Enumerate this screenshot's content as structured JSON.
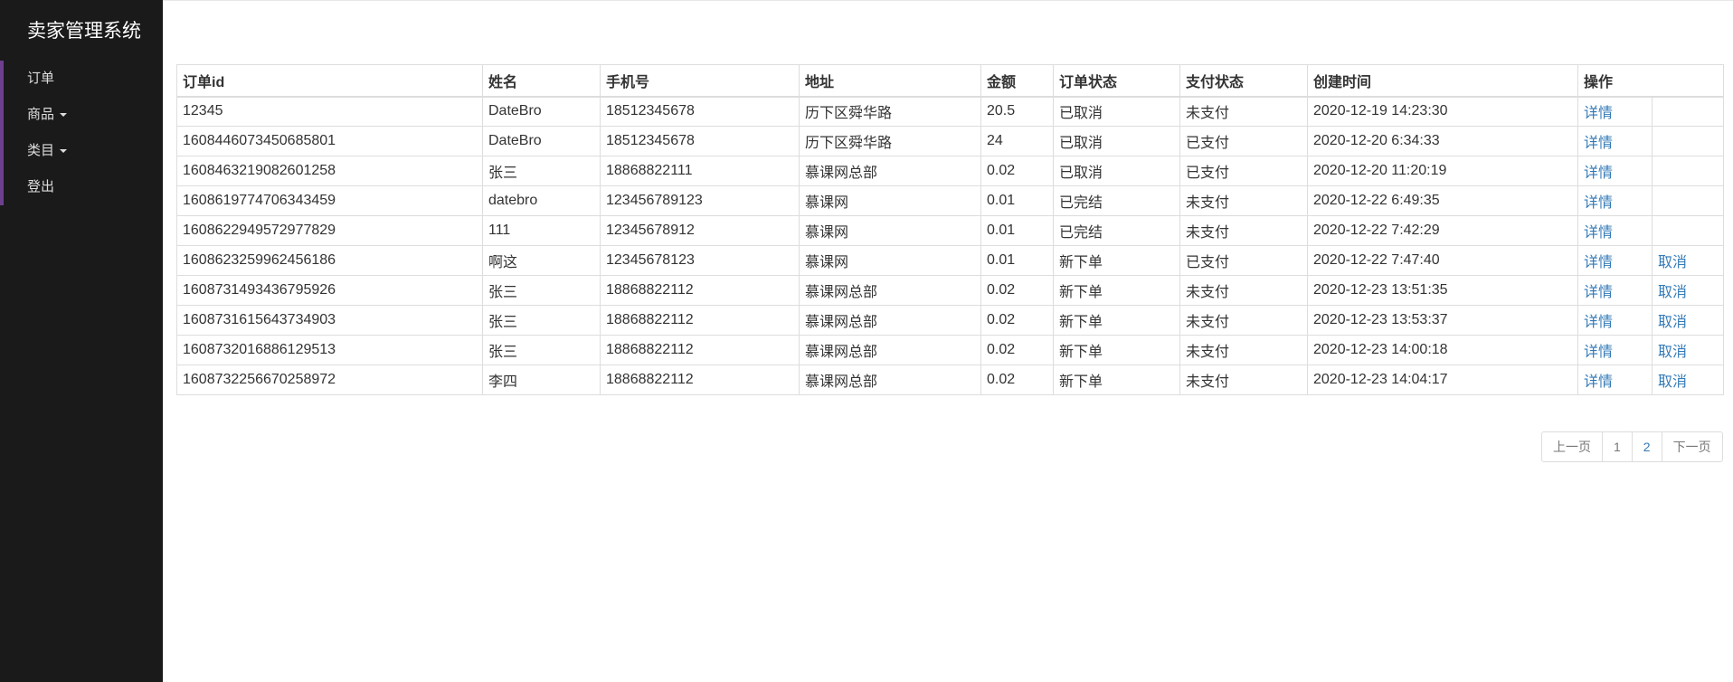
{
  "sidebar": {
    "brand": "卖家管理系统",
    "items": [
      {
        "name": "nav-orders",
        "label": "订单",
        "dropdown": false
      },
      {
        "name": "nav-products",
        "label": "商品",
        "dropdown": true
      },
      {
        "name": "nav-categories",
        "label": "类目",
        "dropdown": true
      },
      {
        "name": "nav-logout",
        "label": "登出",
        "dropdown": false
      }
    ]
  },
  "table": {
    "headers": [
      "订单id",
      "姓名",
      "手机号",
      "地址",
      "金额",
      "订单状态",
      "支付状态",
      "创建时间",
      "操作"
    ],
    "detail_label": "详情",
    "cancel_label": "取消",
    "rows": [
      {
        "id": "12345",
        "name": "DateBro",
        "phone": "18512345678",
        "address": "历下区舜华路",
        "amount": "20.5",
        "order_status": "已取消",
        "pay_status": "未支付",
        "created": "2020-12-19 14:23:30",
        "cancelable": false
      },
      {
        "id": "1608446073450685801",
        "name": "DateBro",
        "phone": "18512345678",
        "address": "历下区舜华路",
        "amount": "24",
        "order_status": "已取消",
        "pay_status": "已支付",
        "created": "2020-12-20 6:34:33",
        "cancelable": false
      },
      {
        "id": "1608463219082601258",
        "name": "张三",
        "phone": "18868822111",
        "address": "慕课网总部",
        "amount": "0.02",
        "order_status": "已取消",
        "pay_status": "已支付",
        "created": "2020-12-20 11:20:19",
        "cancelable": false
      },
      {
        "id": "1608619774706343459",
        "name": "datebro",
        "phone": "123456789123",
        "address": "慕课网",
        "amount": "0.01",
        "order_status": "已完结",
        "pay_status": "未支付",
        "created": "2020-12-22 6:49:35",
        "cancelable": false
      },
      {
        "id": "1608622949572977829",
        "name": "111",
        "phone": "12345678912",
        "address": "慕课网",
        "amount": "0.01",
        "order_status": "已完结",
        "pay_status": "未支付",
        "created": "2020-12-22 7:42:29",
        "cancelable": false
      },
      {
        "id": "1608623259962456186",
        "name": "啊这",
        "phone": "12345678123",
        "address": "慕课网",
        "amount": "0.01",
        "order_status": "新下单",
        "pay_status": "已支付",
        "created": "2020-12-22 7:47:40",
        "cancelable": true
      },
      {
        "id": "1608731493436795926",
        "name": "张三",
        "phone": "18868822112",
        "address": "慕课网总部",
        "amount": "0.02",
        "order_status": "新下单",
        "pay_status": "未支付",
        "created": "2020-12-23 13:51:35",
        "cancelable": true
      },
      {
        "id": "1608731615643734903",
        "name": "张三",
        "phone": "18868822112",
        "address": "慕课网总部",
        "amount": "0.02",
        "order_status": "新下单",
        "pay_status": "未支付",
        "created": "2020-12-23 13:53:37",
        "cancelable": true
      },
      {
        "id": "1608732016886129513",
        "name": "张三",
        "phone": "18868822112",
        "address": "慕课网总部",
        "amount": "0.02",
        "order_status": "新下单",
        "pay_status": "未支付",
        "created": "2020-12-23 14:00:18",
        "cancelable": true
      },
      {
        "id": "1608732256670258972",
        "name": "李四",
        "phone": "18868822112",
        "address": "慕课网总部",
        "amount": "0.02",
        "order_status": "新下单",
        "pay_status": "未支付",
        "created": "2020-12-23 14:04:17",
        "cancelable": true
      }
    ]
  },
  "pagination": {
    "prev_label": "上一页",
    "pages": [
      "1",
      "2"
    ],
    "current_page": "1",
    "next_label": "下一页"
  },
  "colors": {
    "sidebar_bg": "#1a1a1a",
    "nav_accent": "#6e3f8f",
    "link": "#337ab7"
  }
}
